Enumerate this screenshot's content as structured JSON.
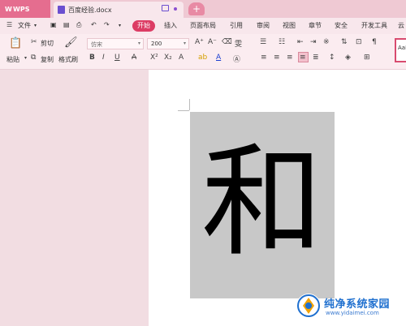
{
  "tabs": {
    "app": "WPS",
    "document": "百度经验.docx"
  },
  "menu": {
    "file": "文件",
    "items": [
      "开始",
      "插入",
      "页面布局",
      "引用",
      "审阅",
      "视图",
      "章节",
      "安全",
      "开发工具",
      "云"
    ]
  },
  "ribbon": {
    "paste": "粘贴",
    "cut": "剪切",
    "copy": "复制",
    "format_painter": "格式刷",
    "font_name": "仿宋",
    "font_size": "200",
    "style_preview": "AaB"
  },
  "document": {
    "content": "和"
  },
  "watermark": {
    "title": "纯净系统家园",
    "url": "www.yidaimei.com"
  },
  "colors": {
    "accent": "#dc3c64",
    "tabbar": "#efc9d3",
    "image_bg": "#c8c8c8"
  }
}
